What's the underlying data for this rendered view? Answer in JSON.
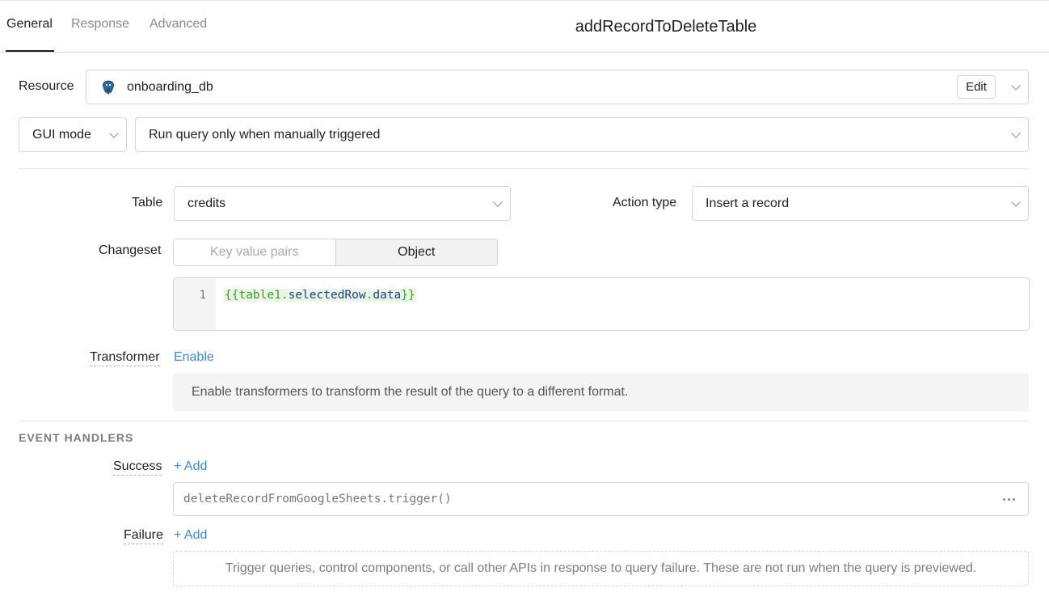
{
  "tabs": [
    {
      "label": "General",
      "active": true
    },
    {
      "label": "Response",
      "active": false
    },
    {
      "label": "Advanced",
      "active": false
    }
  ],
  "query_name": "addRecordToDeleteTable",
  "resource": {
    "label": "Resource",
    "value": "onboarding_db",
    "icon": "postgres-icon",
    "edit_label": "Edit"
  },
  "mode": {
    "value": "GUI mode"
  },
  "trigger": {
    "value": "Run query only when manually triggered"
  },
  "table": {
    "label": "Table",
    "value": "credits"
  },
  "action_type": {
    "label": "Action type",
    "value": "Insert a record"
  },
  "changeset": {
    "label": "Changeset",
    "options": [
      "Key value pairs",
      "Object"
    ],
    "selected": "Object",
    "code_line_number": "1",
    "code": {
      "open": "{{",
      "ident": "table1",
      "dot1": ".",
      "prop1": "selectedRow",
      "dot2": ".",
      "prop2": "data",
      "close": "}}"
    }
  },
  "transformer": {
    "label": "Transformer",
    "enable_label": "Enable",
    "description": "Enable transformers to transform the result of the query to a different format."
  },
  "event_handlers": {
    "title": "EVENT HANDLERS",
    "success": {
      "label": "Success",
      "add_label": "+ Add",
      "handlers": [
        "deleteRecordFromGoogleSheets.trigger()"
      ]
    },
    "failure": {
      "label": "Failure",
      "add_label": "+ Add",
      "empty_text": "Trigger queries, control components, or call other APIs in response to query failure. These are not run when the query is previewed."
    }
  },
  "colors": {
    "link": "#3f86d6",
    "code_highlight_bg": "#eaf6e4",
    "code_green": "#3c9a38",
    "code_blue": "#1f3e8c"
  }
}
